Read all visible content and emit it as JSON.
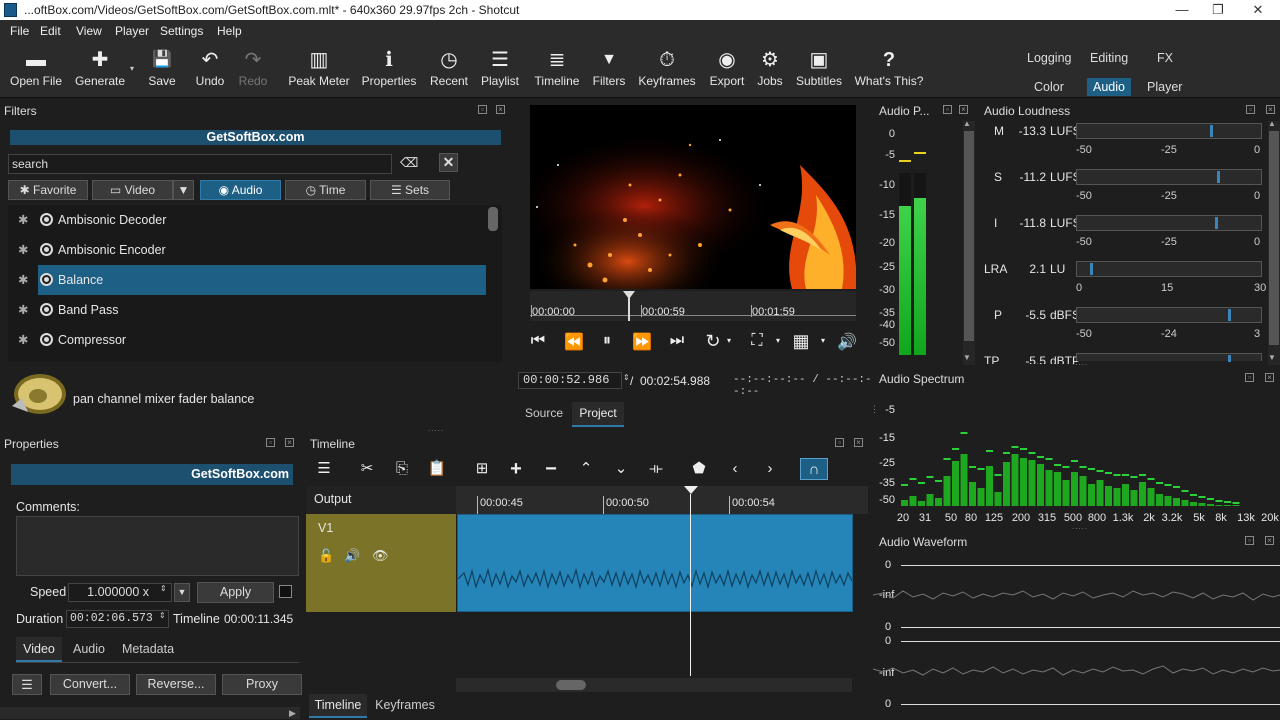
{
  "window": {
    "title": "...oftBox.com/Videos/GetSoftBox.com/GetSoftBox.com.mlt* - 640x360 29.97fps 2ch - Shotcut",
    "minimize": "—",
    "maximize": "❐",
    "close": "✕"
  },
  "menu": [
    "File",
    "Edit",
    "View",
    "Player",
    "Settings",
    "Help"
  ],
  "toolbar": [
    {
      "label": "Open File",
      "icon": "folder-icon",
      "glyph": "▬"
    },
    {
      "label": "Generate",
      "icon": "generate-icon",
      "glyph": "✚"
    },
    {
      "label": "Save",
      "icon": "save-icon",
      "glyph": "💾"
    },
    {
      "label": "Undo",
      "icon": "undo-icon",
      "glyph": "↶"
    },
    {
      "label": "Redo",
      "icon": "redo-icon",
      "glyph": "↷"
    },
    {
      "label": "Peak Meter",
      "icon": "peak-meter-icon",
      "glyph": "▥"
    },
    {
      "label": "Properties",
      "icon": "info-icon",
      "glyph": "ℹ"
    },
    {
      "label": "Recent",
      "icon": "clock-icon",
      "glyph": "◷"
    },
    {
      "label": "Playlist",
      "icon": "list-icon",
      "glyph": "☰"
    },
    {
      "label": "Timeline",
      "icon": "timeline-icon",
      "glyph": "≣"
    },
    {
      "label": "Filters",
      "icon": "funnel-icon",
      "glyph": "▼"
    },
    {
      "label": "Keyframes",
      "icon": "stopwatch-icon",
      "glyph": "⏱"
    },
    {
      "label": "Export",
      "icon": "disc-icon",
      "glyph": "◉"
    },
    {
      "label": "Jobs",
      "icon": "gear-icon",
      "glyph": "⚙"
    },
    {
      "label": "Subtitles",
      "icon": "subtitles-icon",
      "glyph": "▣"
    },
    {
      "label": "What's This?",
      "icon": "question-icon",
      "glyph": "?"
    }
  ],
  "layouts": {
    "row1": [
      "Logging",
      "Editing",
      "FX"
    ],
    "row2": [
      "Color",
      "Audio",
      "Player"
    ],
    "selected": "Audio"
  },
  "filters": {
    "title": "Filters",
    "banner": "GetSoftBox.com",
    "search_value": "search",
    "categories": [
      "Favorite",
      "Video",
      "Audio",
      "Time",
      "Sets"
    ],
    "selected_category": "Audio",
    "items": [
      "Ambisonic Decoder",
      "Ambisonic Encoder",
      "Balance",
      "Band Pass",
      "Compressor"
    ],
    "selected_item": "Balance",
    "description": "pan channel mixer fader balance"
  },
  "player": {
    "ruler": [
      "00:00:00",
      "00:00:59",
      "00:01:59"
    ],
    "position": "00:00:52.986",
    "separator": "/",
    "duration": "00:02:54.988",
    "in_out": "--:--:--:-- / --:--:--:--",
    "tabs": [
      "Source",
      "Project"
    ],
    "selected_tab": "Project"
  },
  "properties": {
    "title": "Properties",
    "banner": "GetSoftBox.com",
    "comments_label": "Comments:",
    "speed_label": "Speed",
    "speed_value": "1.000000 x",
    "apply": "Apply",
    "duration_label": "Duration",
    "duration_value": "00:02:06.573",
    "timeline_label": "Timeline",
    "timeline_value": "00:00:11.345",
    "tabs": [
      "Video",
      "Audio",
      "Metadata"
    ],
    "selected_tab": "Video",
    "actions": [
      "Convert...",
      "Reverse...",
      "Proxy"
    ]
  },
  "timeline": {
    "title": "Timeline",
    "output_label": "Output",
    "track": "V1",
    "ruler": [
      "00:00:45",
      "00:00:50",
      "00:00:54"
    ],
    "bottom_tabs": [
      "Timeline",
      "Keyframes"
    ],
    "selected_tab": "Timeline"
  },
  "audio_peak": {
    "title": "Audio P...",
    "scale": [
      "0",
      "-5",
      "-10",
      "-15",
      "-20",
      "-25",
      "-30",
      "-35",
      "-40",
      "-50"
    ],
    "left_level": 0.82,
    "right_level": 0.86
  },
  "loudness": {
    "title": "Audio Loudness",
    "rows": [
      {
        "label": "M",
        "value": "-13.3",
        "unit": "LUFS",
        "scale": [
          "-50",
          "-25",
          "0"
        ],
        "level": 0.73
      },
      {
        "label": "S",
        "value": "-11.2",
        "unit": "LUFS",
        "scale": [
          "-50",
          "-25",
          "0"
        ],
        "level": 0.77
      },
      {
        "label": "I",
        "value": "-11.8",
        "unit": "LUFS",
        "scale": [
          "-50",
          "-25",
          "0"
        ],
        "level": 0.76
      },
      {
        "label": "LRA",
        "value": "2.1",
        "unit": "LU",
        "scale": [
          "0",
          "15",
          "30"
        ],
        "level": 0.07
      },
      {
        "label": "P",
        "value": "-5.5",
        "unit": "dBFS",
        "scale": [
          "-50",
          "-24",
          "3"
        ],
        "level": 0.83
      },
      {
        "label": "TP",
        "value": "-5.5",
        "unit": "dBTP",
        "scale": [],
        "level": 0.83
      }
    ]
  },
  "spectrum": {
    "title": "Audio Spectrum",
    "y": [
      "-5",
      "-15",
      "-25",
      "-35",
      "-50"
    ],
    "x": [
      "20",
      "31",
      "50",
      "80",
      "125",
      "200",
      "315",
      "500",
      "800",
      "1.3k",
      "2k",
      "3.2k",
      "5k",
      "8k",
      "13k",
      "20k"
    ]
  },
  "waveform": {
    "title": "Audio Waveform",
    "labels": [
      "0",
      "-inf",
      "0",
      "0",
      "-inf",
      "0"
    ]
  }
}
